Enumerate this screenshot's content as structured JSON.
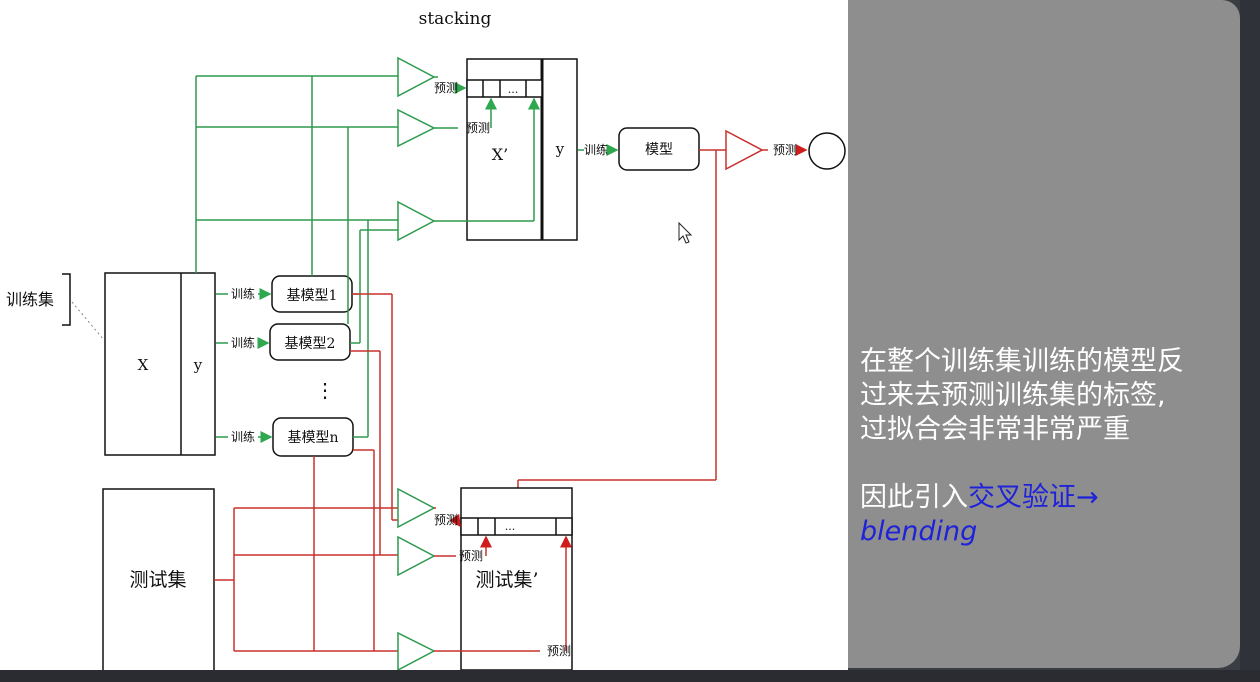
{
  "diagram": {
    "title": "stacking",
    "training_set_label": "训练集",
    "x_label": "X",
    "y_label": "y",
    "train_label": "训练",
    "predict_label": "预测",
    "base_models": [
      "基模型1",
      "基模型2",
      "基模型n"
    ],
    "vertical_ellipsis": "⋮",
    "x_prime_label": "X’",
    "meta_y_label": "y",
    "meta_model_label": "模型",
    "row_ellipsis": "...",
    "test_set_label": "测试集",
    "test_prime_label": "测试集’",
    "colors": {
      "train": "#2e9a4e",
      "test": "#c8302c",
      "arrow_green": "#2ea74f",
      "arrow_red": "#d01c1c"
    }
  },
  "note": {
    "line1": "在整个训练集训练的模型反",
    "line2": "过来去预测训练集的标签,",
    "line3": "过拟合会非常非常严重",
    "line4_prefix": "因此引入",
    "line4_highlight": "交叉验证→",
    "line5": "blending"
  }
}
